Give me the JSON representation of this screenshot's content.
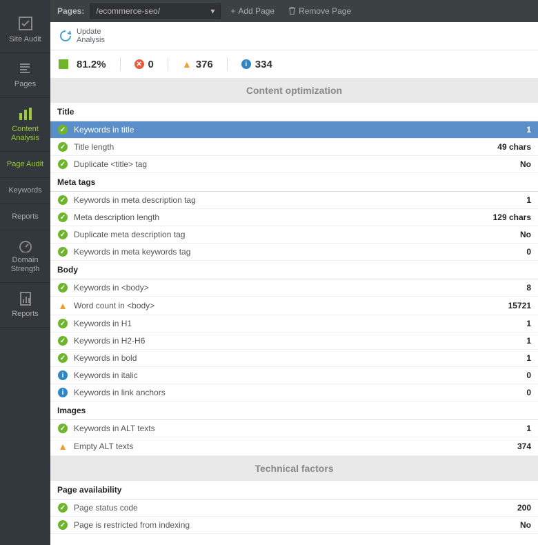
{
  "sidebar": {
    "items": [
      {
        "label": "Site Audit",
        "icon": "check-box"
      },
      {
        "label": "Pages",
        "icon": "pages"
      },
      {
        "label": "Content Analysis",
        "icon": "content"
      },
      {
        "label": "Page Audit",
        "icon": "page-audit"
      },
      {
        "label": "Keywords",
        "icon": "keywords"
      },
      {
        "label": "Reports",
        "icon": "reports"
      },
      {
        "label": "Domain Strength",
        "icon": "gauge"
      },
      {
        "label": "Reports",
        "icon": "reports2"
      }
    ]
  },
  "toolbar": {
    "pages_label": "Pages:",
    "page_value": "/ecommerce-seo/",
    "add_label": "Add Page",
    "remove_label": "Remove Page"
  },
  "update": {
    "line1": "Update",
    "line2": "Analysis"
  },
  "stats": {
    "pct": "81.2%",
    "errors": "0",
    "warnings": "376",
    "info": "334"
  },
  "sections": {
    "content_opt": "Content optimization",
    "technical": "Technical factors"
  },
  "groups": {
    "title": "Title",
    "meta": "Meta tags",
    "body": "Body",
    "images": "Images",
    "availability": "Page availability"
  },
  "rows": {
    "title": [
      {
        "icon": "ok",
        "label": "Keywords in title",
        "value": "1",
        "selected": true
      },
      {
        "icon": "ok",
        "label": "Title length",
        "value": "49 chars"
      },
      {
        "icon": "ok",
        "label": "Duplicate <title> tag",
        "value": "No"
      }
    ],
    "meta": [
      {
        "icon": "ok",
        "label": "Keywords in meta description tag",
        "value": "1"
      },
      {
        "icon": "ok",
        "label": "Meta description length",
        "value": "129 chars"
      },
      {
        "icon": "ok",
        "label": "Duplicate meta description tag",
        "value": "No"
      },
      {
        "icon": "ok",
        "label": "Keywords in meta keywords tag",
        "value": "0"
      }
    ],
    "body": [
      {
        "icon": "ok",
        "label": "Keywords in <body>",
        "value": "8"
      },
      {
        "icon": "warn",
        "label": "Word count in <body>",
        "value": "15721"
      },
      {
        "icon": "ok",
        "label": "Keywords in H1",
        "value": "1"
      },
      {
        "icon": "ok",
        "label": "Keywords in H2-H6",
        "value": "1"
      },
      {
        "icon": "ok",
        "label": "Keywords in bold",
        "value": "1"
      },
      {
        "icon": "info",
        "label": "Keywords in italic",
        "value": "0"
      },
      {
        "icon": "info",
        "label": "Keywords in link anchors",
        "value": "0"
      }
    ],
    "images": [
      {
        "icon": "ok",
        "label": "Keywords in ALT texts",
        "value": "1"
      },
      {
        "icon": "warn",
        "label": "Empty ALT texts",
        "value": "374"
      }
    ],
    "availability": [
      {
        "icon": "ok",
        "label": "Page status code",
        "value": "200"
      },
      {
        "icon": "ok",
        "label": "Page is restricted from indexing",
        "value": "No"
      }
    ]
  }
}
